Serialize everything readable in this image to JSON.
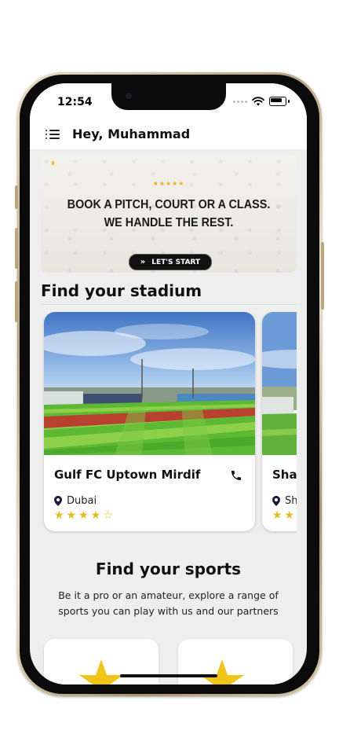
{
  "status_bar": {
    "time": "12:54"
  },
  "app_bar": {
    "greeting": "Hey, Muhammad"
  },
  "banner": {
    "rating": "★★★★★",
    "headline_line1": "BOOK A PITCH, COURT OR A CLASS.",
    "headline_line2": "WE HANDLE THE REST.",
    "cta_label": "LET'S START",
    "cta_icon": "double-chevron-right-icon"
  },
  "stadium_section": {
    "title": "Find your stadium",
    "stadiums": [
      {
        "name": "Gulf FC Uptown Mirdif",
        "location": "Dubai",
        "stars": "★★★★☆",
        "rating": 4
      },
      {
        "name": "Sha",
        "location": "Sh",
        "stars": "★★",
        "rating": 2
      }
    ]
  },
  "sports_section": {
    "title": "Find your sports",
    "subtitle": "Be it a pro or an amateur, explore a range of sports you can play with us and our partners"
  },
  "colors": {
    "accent": "#F0C419",
    "star": "#E8B820",
    "text": "#111111",
    "pin": "#1C1C3A"
  }
}
